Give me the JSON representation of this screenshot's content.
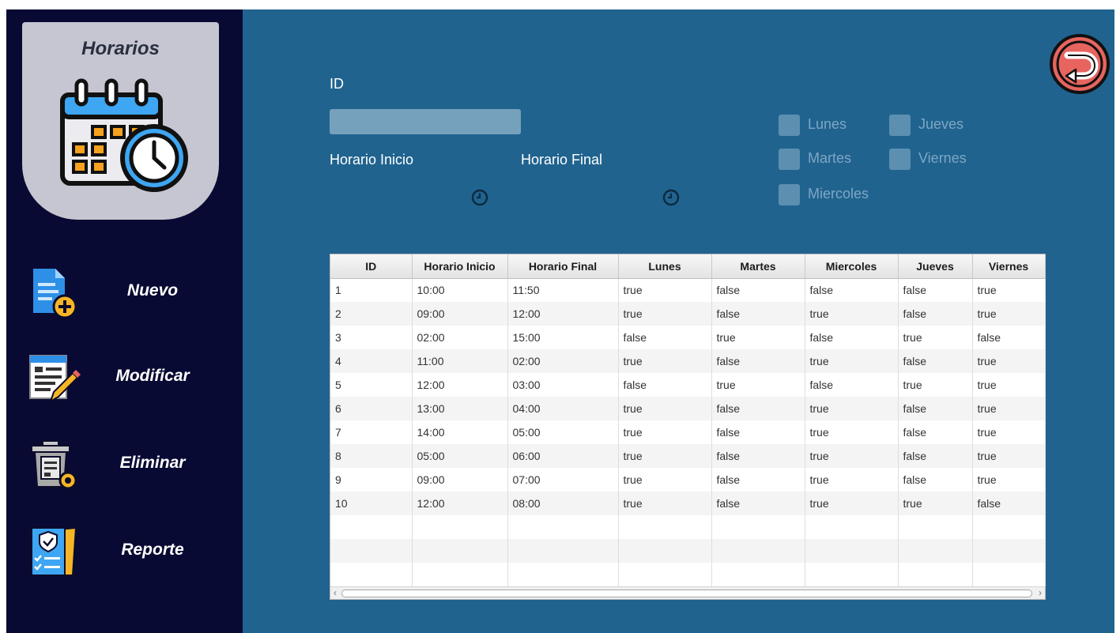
{
  "sidebar": {
    "header_title": "Horarios",
    "items": [
      {
        "label": "Nuevo",
        "icon": "new-document-icon"
      },
      {
        "label": "Modificar",
        "icon": "edit-document-icon"
      },
      {
        "label": "Eliminar",
        "icon": "delete-trash-icon"
      },
      {
        "label": "Reporte",
        "icon": "report-checklist-icon"
      }
    ]
  },
  "form": {
    "id_label": "ID",
    "id_value": "",
    "start_label": "Horario Inicio",
    "end_label": "Horario Final",
    "days": {
      "lunes": "Lunes",
      "martes": "Martes",
      "miercoles": "Miercoles",
      "jueves": "Jueves",
      "viernes": "Viernes"
    }
  },
  "table": {
    "columns": [
      "ID",
      "Horario Inicio",
      "Horario Final",
      "Lunes",
      "Martes",
      "Miercoles",
      "Jueves",
      "Viernes"
    ],
    "rows": [
      [
        "1",
        "10:00",
        "11:50",
        "true",
        "false",
        "false",
        "false",
        "true"
      ],
      [
        "2",
        "09:00",
        "12:00",
        "true",
        "false",
        "true",
        "false",
        "true"
      ],
      [
        "3",
        "02:00",
        "15:00",
        "false",
        "true",
        "false",
        "true",
        "false"
      ],
      [
        "4",
        "11:00",
        "02:00",
        "true",
        "false",
        "true",
        "false",
        "true"
      ],
      [
        "5",
        "12:00",
        "03:00",
        "false",
        "true",
        "false",
        "true",
        "true"
      ],
      [
        "6",
        "13:00",
        "04:00",
        "true",
        "false",
        "true",
        "false",
        "true"
      ],
      [
        "7",
        "14:00",
        "05:00",
        "true",
        "false",
        "true",
        "false",
        "true"
      ],
      [
        "8",
        "05:00",
        "06:00",
        "true",
        "false",
        "true",
        "false",
        "true"
      ],
      [
        "9",
        "09:00",
        "07:00",
        "true",
        "false",
        "true",
        "false",
        "true"
      ],
      [
        "10",
        "12:00",
        "08:00",
        "true",
        "false",
        "true",
        "true",
        "false"
      ]
    ]
  },
  "colors": {
    "sidebar_bg": "#090a33",
    "main_bg": "#20638f",
    "header_card": "#c6c6d2",
    "back_button": "#e8645f"
  }
}
